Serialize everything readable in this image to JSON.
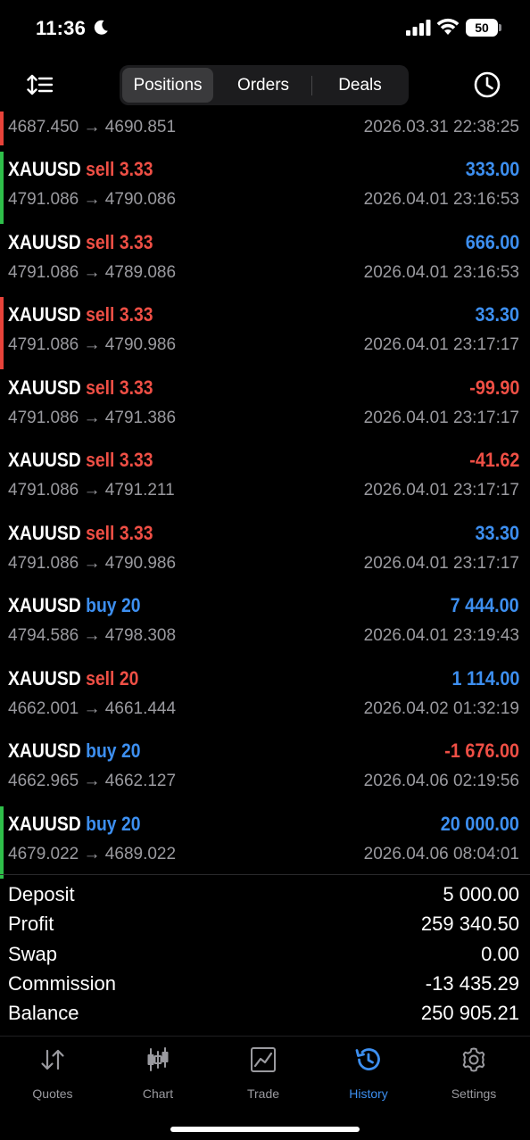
{
  "status_bar": {
    "time": "11:36",
    "battery": "50"
  },
  "nav": {
    "segments": [
      "Positions",
      "Orders",
      "Deals"
    ],
    "active_segment": "Positions"
  },
  "deals": [
    {
      "symbol": "",
      "direction": "",
      "volume": "",
      "profit": "",
      "profit_sign": "",
      "prices": "4687.450 → 4690.851",
      "time": "2026.03.31 22:38:25",
      "marker_color": "#e8433a"
    },
    {
      "symbol": "XAUUSD",
      "direction": "sell",
      "volume": "3.33",
      "profit": "333.00",
      "profit_sign": "pos",
      "prices": "4791.086 → 4790.086",
      "time": "2026.04.01 23:16:53",
      "marker_color": "#2fbf4a"
    },
    {
      "symbol": "XAUUSD",
      "direction": "sell",
      "volume": "3.33",
      "profit": "666.00",
      "profit_sign": "pos",
      "prices": "4791.086 → 4789.086",
      "time": "2026.04.01 23:16:53",
      "marker_color": ""
    },
    {
      "symbol": "XAUUSD",
      "direction": "sell",
      "volume": "3.33",
      "profit": "33.30",
      "profit_sign": "pos",
      "prices": "4791.086 → 4790.986",
      "time": "2026.04.01 23:17:17",
      "marker_color": "#e8433a"
    },
    {
      "symbol": "XAUUSD",
      "direction": "sell",
      "volume": "3.33",
      "profit": "-99.90",
      "profit_sign": "neg",
      "prices": "4791.086 → 4791.386",
      "time": "2026.04.01 23:17:17",
      "marker_color": ""
    },
    {
      "symbol": "XAUUSD",
      "direction": "sell",
      "volume": "3.33",
      "profit": "-41.62",
      "profit_sign": "neg",
      "prices": "4791.086 → 4791.211",
      "time": "2026.04.01 23:17:17",
      "marker_color": ""
    },
    {
      "symbol": "XAUUSD",
      "direction": "sell",
      "volume": "3.33",
      "profit": "33.30",
      "profit_sign": "pos",
      "prices": "4791.086 → 4790.986",
      "time": "2026.04.01 23:17:17",
      "marker_color": ""
    },
    {
      "symbol": "XAUUSD",
      "direction": "buy",
      "volume": "20",
      "profit": "7 444.00",
      "profit_sign": "pos",
      "prices": "4794.586 → 4798.308",
      "time": "2026.04.01 23:19:43",
      "marker_color": ""
    },
    {
      "symbol": "XAUUSD",
      "direction": "sell",
      "volume": "20",
      "profit": "1 114.00",
      "profit_sign": "pos",
      "prices": "4662.001 → 4661.444",
      "time": "2026.04.02 01:32:19",
      "marker_color": ""
    },
    {
      "symbol": "XAUUSD",
      "direction": "buy",
      "volume": "20",
      "profit": "-1 676.00",
      "profit_sign": "neg",
      "prices": "4662.965 → 4662.127",
      "time": "2026.04.06 02:19:56",
      "marker_color": ""
    },
    {
      "symbol": "XAUUSD",
      "direction": "buy",
      "volume": "20",
      "profit": "20 000.00",
      "profit_sign": "pos",
      "prices": "4679.022 → 4689.022",
      "time": "2026.04.06 08:04:01",
      "marker_color": "#2fbf4a"
    }
  ],
  "summary": [
    {
      "label": "Deposit",
      "value": "5 000.00"
    },
    {
      "label": "Profit",
      "value": "259 340.50"
    },
    {
      "label": "Swap",
      "value": "0.00"
    },
    {
      "label": "Commission",
      "value": "-13 435.29"
    },
    {
      "label": "Balance",
      "value": "250 905.21"
    }
  ],
  "tabs": [
    {
      "label": "Quotes",
      "icon": "quotes-icon"
    },
    {
      "label": "Chart",
      "icon": "chart-icon"
    },
    {
      "label": "Trade",
      "icon": "trade-icon"
    },
    {
      "label": "History",
      "icon": "history-icon"
    },
    {
      "label": "Settings",
      "icon": "settings-icon"
    }
  ],
  "active_tab": "History",
  "colors": {
    "accent": "#3d8ff0",
    "negative": "#ef4f45",
    "positive_marker": "#2fbf4a"
  }
}
